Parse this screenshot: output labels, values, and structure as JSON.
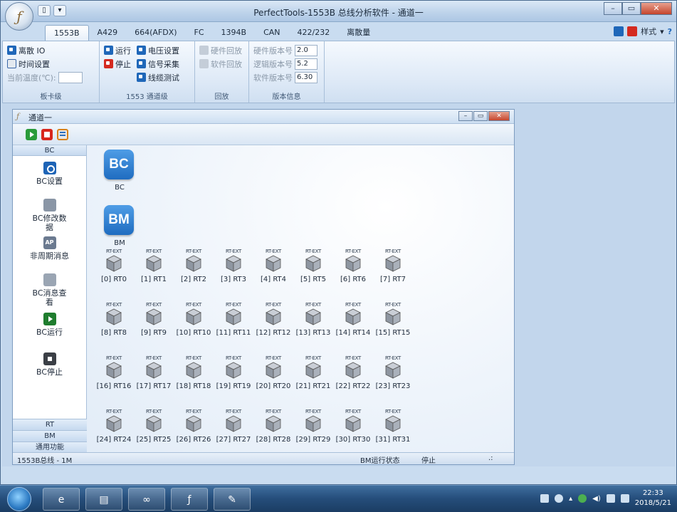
{
  "window": {
    "title": "PerfectTools-1553B 总线分析软件 - 通道一",
    "controls": [
      "minimize",
      "maximize",
      "close"
    ]
  },
  "ribbon_tabs": [
    {
      "label": "1553B",
      "active": true
    },
    {
      "label": "A429"
    },
    {
      "label": "664(AFDX)"
    },
    {
      "label": "FC"
    },
    {
      "label": "1394B"
    },
    {
      "label": "CAN"
    },
    {
      "label": "422/232"
    },
    {
      "label": "离散量"
    }
  ],
  "ribbon_right": {
    "style_label": "样式"
  },
  "ribbon": {
    "board": {
      "label": "板卡级",
      "discrete_io": "离散 IO",
      "time_settings": "时间设置",
      "temperature_label": "当前温度(℃):"
    },
    "channel": {
      "label": "1553 通道级",
      "run": "运行",
      "stop": "停止",
      "voltage": "电压设置",
      "signal": "信号采集",
      "cable_test": "线缆测试"
    },
    "playback": {
      "label": "回放",
      "hw_playback": "硬件回放",
      "sw_playback": "软件回放"
    },
    "version": {
      "label": "版本信息",
      "hw_label": "硬件版本号",
      "hw_value": "2.0",
      "logic_label": "逻辑版本号",
      "logic_value": "5.2",
      "sw_label": "软件版本号",
      "sw_value": "6.30"
    }
  },
  "child": {
    "title": "通道一",
    "nav": {
      "header": "BC",
      "items": [
        {
          "label": "BC设置"
        },
        {
          "label": "BC修改数据"
        },
        {
          "label": "非周期消息"
        },
        {
          "label": "BC消息查看"
        },
        {
          "label": "BC运行"
        },
        {
          "label": "BC停止"
        }
      ],
      "footers": [
        "RT",
        "BM",
        "通用功能"
      ]
    },
    "canvas": {
      "bc": {
        "icon_text": "BC",
        "caption": "BC"
      },
      "bm": {
        "icon_text": "BM",
        "caption": "BM"
      },
      "rt_tag": "RT-EXT",
      "rts": [
        "[0] RT0",
        "[1] RT1",
        "[2] RT2",
        "[3] RT3",
        "[4] RT4",
        "[5] RT5",
        "[6] RT6",
        "[7] RT7",
        "[8] RT8",
        "[9] RT9",
        "[10] RT10",
        "[11] RT11",
        "[12] RT12",
        "[13] RT13",
        "[14] RT14",
        "[15] RT15",
        "[16] RT16",
        "[17] RT17",
        "[18] RT18",
        "[19] RT19",
        "[20] RT20",
        "[21] RT21",
        "[22] RT22",
        "[23] RT23",
        "[24] RT24",
        "[25] RT25",
        "[26] RT26",
        "[27] RT27",
        "[28] RT28",
        "[29] RT29",
        "[30] RT30",
        "[31] RT31"
      ]
    },
    "status": {
      "bus": "1553B总线 - 1M",
      "bm_label": "BM运行状态",
      "bm_value": "停止"
    }
  },
  "taskbar": {
    "clock_time": "22:33",
    "clock_date": "2018/5/21"
  }
}
